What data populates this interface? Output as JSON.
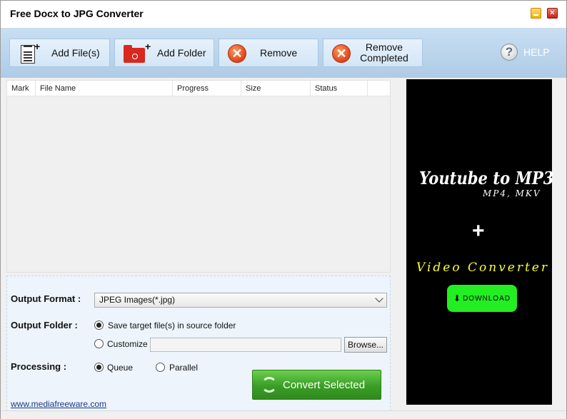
{
  "window": {
    "title": "Free Docx to JPG Converter",
    "close_glyph": "×"
  },
  "toolbar": {
    "add_files_label": "Add File(s)",
    "add_folder_label": "Add Folder",
    "remove_label": "Remove",
    "remove_completed_line1": "Remove",
    "remove_completed_line2": "Completed",
    "help_label": "HELP"
  },
  "file_list": {
    "columns": [
      "Mark",
      "File Name",
      "Progress",
      "Size",
      "Status"
    ],
    "rows": []
  },
  "options": {
    "output_format_label": "Output Format :",
    "output_format_value": "JPEG Images(*.jpg)",
    "output_folder_label": "Output Folder :",
    "save_in_source_label": "Save target file(s) in source folder",
    "customize_label": "Customize :",
    "customize_value": "",
    "browse_label": "Browse...",
    "processing_label": "Processing :",
    "queue_label": "Queue",
    "parallel_label": "Parallel",
    "selected_folder_option": "source",
    "selected_processing": "queue"
  },
  "convert_label": "Convert Selected",
  "website": "www.mediafreeware.com",
  "ad": {
    "title": "Youtube to MP3",
    "subtitle": "MP4, MKV",
    "plus": "+",
    "video_text": "Video Converter",
    "download_label": "DOWNLOAD",
    "download_color": "#22ee22"
  }
}
